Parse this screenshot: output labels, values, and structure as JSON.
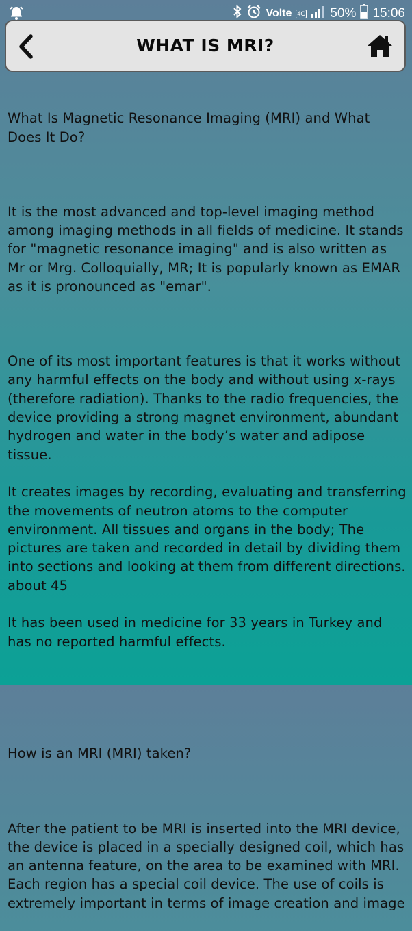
{
  "status_bar": {
    "network": "Volte",
    "network_badge": "4G",
    "battery": "50%",
    "time": "15:06",
    "icons": [
      "alarm-bell-icon",
      "bluetooth-icon",
      "alarm-clock-icon",
      "signal-icon",
      "battery-icon"
    ]
  },
  "header": {
    "title": "WHAT IS MRI?",
    "back_icon": "chevron-left-icon",
    "home_icon": "home-icon"
  },
  "content": {
    "heading1": "What Is Magnetic Resonance Imaging (MRI) and What Does It Do?",
    "para1": "It is the most advanced and top-level imaging method among imaging methods in all fields of medicine. It stands for \"magnetic resonance imaging\" and is also written as Mr or Mrg. Colloquially, MR; It is popularly known as EMAR as it is pronounced as \"emar\".",
    "para2": "One of its most important features is that it works without any harmful effects on the body and without using x-rays (therefore radiation). Thanks to the radio frequencies, the device providing a strong magnet environment, abundant hydrogen and water in the body’s water and adipose tissue.",
    "para3": "It creates images by recording, evaluating and transferring the movements of neutron atoms to the computer environment. All tissues and organs in the body; The pictures are taken and recorded in detail by dividing them into sections and looking at them from different directions. about 45",
    "para4": "It has been used in medicine for 33 years in Turkey and has no reported harmful effects.",
    "heading2": "How is an MRI (MRI) taken?",
    "para5": "After the patient to be MRI is inserted into the MRI device, the device is placed in a specially designed coil, which has an antenna feature, on the area to be examined with MRI. Each region has a special coil device. The use of coils is extremely important in terms of image creation and image"
  },
  "colors": {
    "header_bg": "#e4e4e4",
    "header_border": "#5a5a5a",
    "bg_top": "#5d7f99",
    "bg_bottom": "#0ca196"
  }
}
